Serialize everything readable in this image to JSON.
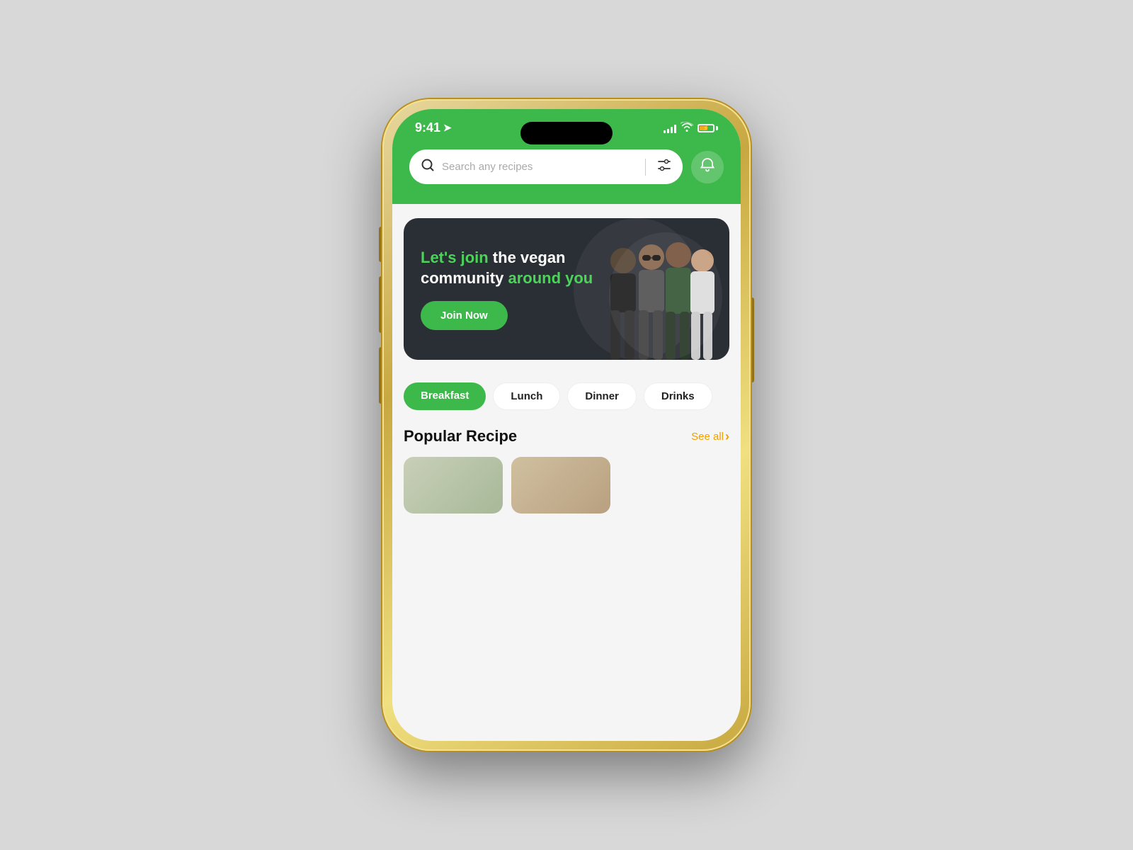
{
  "phone": {
    "status_bar": {
      "time": "9:41",
      "signal_bars": [
        4,
        6,
        8,
        10,
        12
      ],
      "wifi": "wifi",
      "battery_percent": 60
    },
    "header": {
      "search_placeholder": "Search any recipes",
      "filter_icon": "sliders",
      "notification_icon": "bell"
    },
    "banner": {
      "line1": "Let's join",
      "line1_suffix": " the vegan",
      "line2_prefix": "community ",
      "line2": "around you",
      "join_label": "Join Now"
    },
    "categories": [
      {
        "label": "Breakfast",
        "active": true
      },
      {
        "label": "Lunch",
        "active": false
      },
      {
        "label": "Dinner",
        "active": false
      },
      {
        "label": "Drinks",
        "active": false
      }
    ],
    "popular_section": {
      "title": "Popular Recipe",
      "see_all_label": "See all",
      "chevron": "›"
    }
  },
  "colors": {
    "green": "#3db84b",
    "dark_card": "#2a2e35",
    "orange": "#f0a000",
    "white": "#ffffff"
  }
}
